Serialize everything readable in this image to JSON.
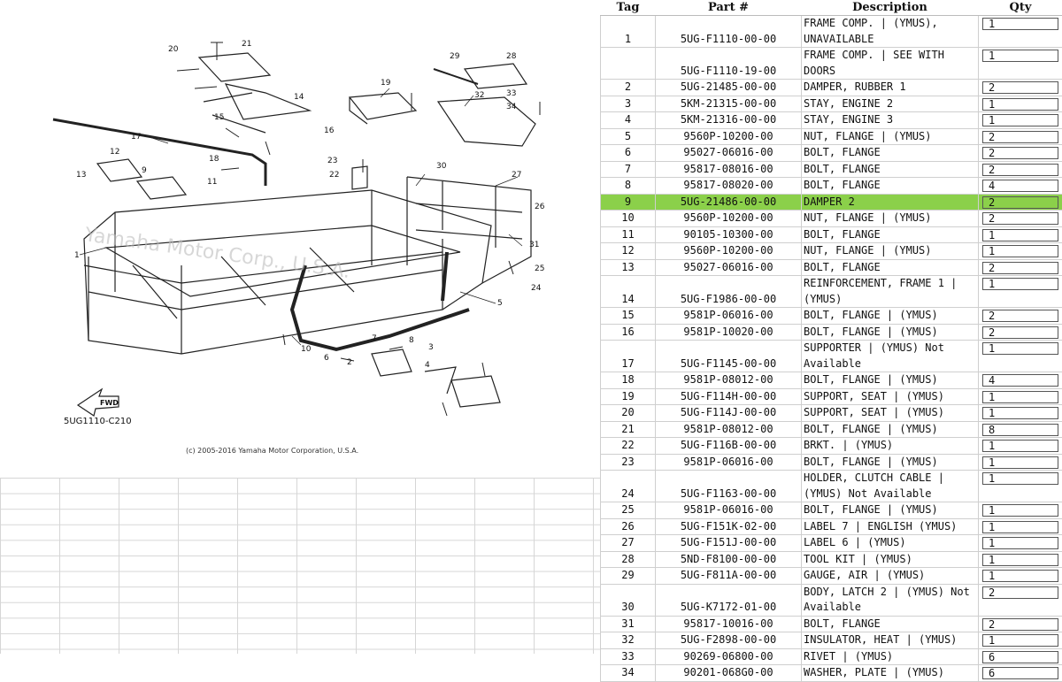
{
  "diagram": {
    "code": "5UG1110-C210",
    "copyright": "(c) 2005-2016 Yamaha Motor Corporation, U.S.A.",
    "watermark": "Yamaha Motor Corp., U.S.A.",
    "fwd_label": "FWD",
    "callouts": [
      "1",
      "2",
      "3",
      "4",
      "5",
      "6",
      "7",
      "8",
      "9",
      "10",
      "11",
      "12",
      "13",
      "14",
      "15",
      "16",
      "17",
      "18",
      "19",
      "20",
      "21",
      "22",
      "23",
      "24",
      "25",
      "26",
      "27",
      "28",
      "29",
      "30",
      "31",
      "32",
      "33",
      "34"
    ]
  },
  "table": {
    "headers": {
      "tag": "Tag",
      "part": "Part #",
      "desc": "Description",
      "qty": "Qty"
    },
    "highlight_color": "#8bd04a",
    "rows": [
      {
        "tag": "1",
        "part": "5UG-F1110-00-00",
        "desc": "FRAME COMP. | (YMUS), UNAVAILABLE",
        "qty": "1"
      },
      {
        "tag": "",
        "part": "5UG-F1110-19-00",
        "desc": "FRAME COMP. | SEE WITH DOORS",
        "qty": "1"
      },
      {
        "tag": "2",
        "part": "5UG-21485-00-00",
        "desc": "DAMPER, RUBBER 1",
        "qty": "2"
      },
      {
        "tag": "3",
        "part": "5KM-21315-00-00",
        "desc": "STAY, ENGINE 2",
        "qty": "1"
      },
      {
        "tag": "4",
        "part": "5KM-21316-00-00",
        "desc": "STAY, ENGINE 3",
        "qty": "1"
      },
      {
        "tag": "5",
        "part": "9560P-10200-00",
        "desc": "NUT, FLANGE | (YMUS)",
        "qty": "2"
      },
      {
        "tag": "6",
        "part": "95027-06016-00",
        "desc": "BOLT, FLANGE",
        "qty": "2"
      },
      {
        "tag": "7",
        "part": "95817-08016-00",
        "desc": "BOLT, FLANGE",
        "qty": "2"
      },
      {
        "tag": "8",
        "part": "95817-08020-00",
        "desc": "BOLT, FLANGE",
        "qty": "4"
      },
      {
        "tag": "9",
        "part": "5UG-21486-00-00",
        "desc": "DAMPER 2",
        "qty": "2",
        "highlight": true
      },
      {
        "tag": "10",
        "part": "9560P-10200-00",
        "desc": "NUT, FLANGE | (YMUS)",
        "qty": "2"
      },
      {
        "tag": "11",
        "part": "90105-10300-00",
        "desc": "BOLT, FLANGE",
        "qty": "1"
      },
      {
        "tag": "12",
        "part": "9560P-10200-00",
        "desc": "NUT, FLANGE | (YMUS)",
        "qty": "1"
      },
      {
        "tag": "13",
        "part": "95027-06016-00",
        "desc": "BOLT, FLANGE",
        "qty": "2"
      },
      {
        "tag": "14",
        "part": "5UG-F1986-00-00",
        "desc": "REINFORCEMENT, FRAME 1 | (YMUS)",
        "qty": "1"
      },
      {
        "tag": "15",
        "part": "9581P-06016-00",
        "desc": "BOLT, FLANGE | (YMUS)",
        "qty": "2"
      },
      {
        "tag": "16",
        "part": "9581P-10020-00",
        "desc": "BOLT, FLANGE | (YMUS)",
        "qty": "2"
      },
      {
        "tag": "17",
        "part": "5UG-F1145-00-00",
        "desc": "SUPPORTER | (YMUS) Not Available",
        "qty": "1"
      },
      {
        "tag": "18",
        "part": "9581P-08012-00",
        "desc": "BOLT, FLANGE | (YMUS)",
        "qty": "4"
      },
      {
        "tag": "19",
        "part": "5UG-F114H-00-00",
        "desc": "SUPPORT, SEAT | (YMUS)",
        "qty": "1"
      },
      {
        "tag": "20",
        "part": "5UG-F114J-00-00",
        "desc": "SUPPORT, SEAT | (YMUS)",
        "qty": "1"
      },
      {
        "tag": "21",
        "part": "9581P-08012-00",
        "desc": "BOLT, FLANGE | (YMUS)",
        "qty": "8"
      },
      {
        "tag": "22",
        "part": "5UG-F116B-00-00",
        "desc": "BRKT. | (YMUS)",
        "qty": "1"
      },
      {
        "tag": "23",
        "part": "9581P-06016-00",
        "desc": "BOLT, FLANGE | (YMUS)",
        "qty": "1"
      },
      {
        "tag": "24",
        "part": "5UG-F1163-00-00",
        "desc": "HOLDER, CLUTCH CABLE | (YMUS) Not Available",
        "qty": "1"
      },
      {
        "tag": "25",
        "part": "9581P-06016-00",
        "desc": "BOLT, FLANGE | (YMUS)",
        "qty": "1"
      },
      {
        "tag": "26",
        "part": "5UG-F151K-02-00",
        "desc": "LABEL 7 | ENGLISH (YMUS)",
        "qty": "1"
      },
      {
        "tag": "27",
        "part": "5UG-F151J-00-00",
        "desc": "LABEL 6 | (YMUS)",
        "qty": "1"
      },
      {
        "tag": "28",
        "part": "5ND-F8100-00-00",
        "desc": "TOOL KIT | (YMUS)",
        "qty": "1"
      },
      {
        "tag": "29",
        "part": "5UG-F811A-00-00",
        "desc": "GAUGE, AIR | (YMUS)",
        "qty": "1"
      },
      {
        "tag": "30",
        "part": "5UG-K7172-01-00",
        "desc": "BODY, LATCH 2 | (YMUS) Not Available",
        "qty": "2"
      },
      {
        "tag": "31",
        "part": "95817-10016-00",
        "desc": "BOLT, FLANGE",
        "qty": "2"
      },
      {
        "tag": "32",
        "part": "5UG-F2898-00-00",
        "desc": "INSULATOR, HEAT | (YMUS)",
        "qty": "1"
      },
      {
        "tag": "33",
        "part": "90269-06800-00",
        "desc": "RIVET | (YMUS)",
        "qty": "6"
      },
      {
        "tag": "34",
        "part": "90201-068G0-00",
        "desc": "WASHER, PLATE | (YMUS)",
        "qty": "6"
      }
    ]
  }
}
